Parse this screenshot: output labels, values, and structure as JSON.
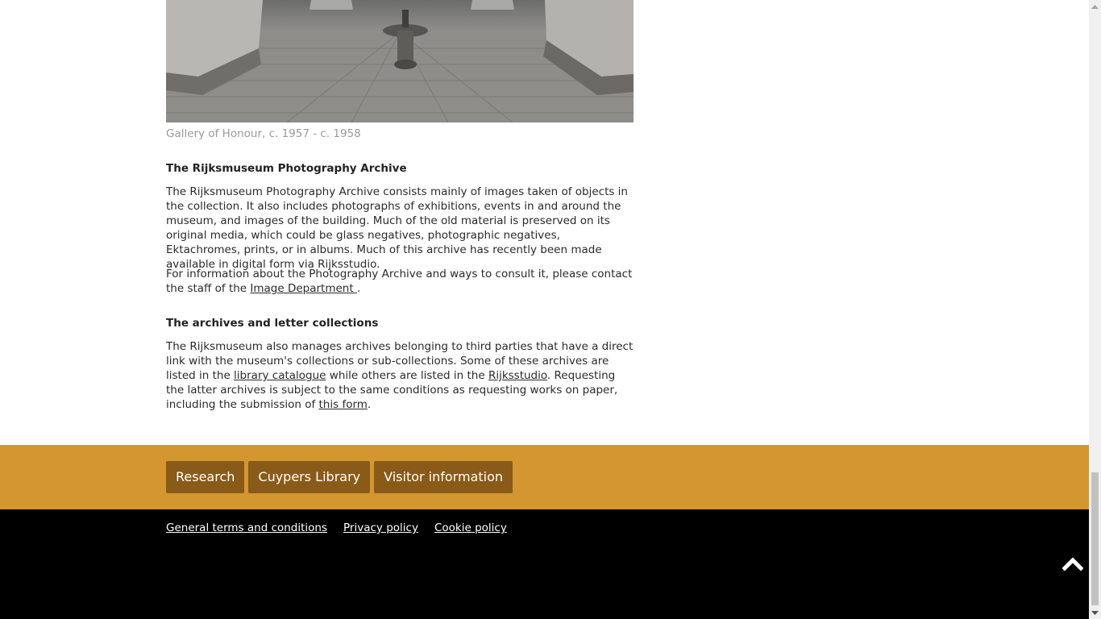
{
  "photo": {
    "alt": "Gallery of Honour, c. 1957 - c. 1958",
    "caption": "Gallery of Honour, c. 1957 - c. 1958"
  },
  "photo_archive": {
    "heading": "The Rijksmuseum Photography Archive",
    "paragraph1": "The Rijksmuseum Photography Archive consists mainly of images taken of objects in the collection. It also includes photographs of exhibitions, events in and around the museum, and images of the building. Much of the old material is preserved on its original media, which could be glass negatives, photographic negatives, Ektachromes, prints, or in albums. Much of this archive has recently been made available in digital form via Rijksstudio.",
    "paragraph2_before": "For information about the Photography Archive and ways to consult it, please contact the staff of the ",
    "paragraph2_link": "Image Department ",
    "paragraph2_after": "."
  },
  "archives": {
    "heading": "The archives and letter collections",
    "text1": "The Rijksmuseum also manages archives belonging to third parties that have a direct link with the museum's collections or sub-collections. Some of these archives are listed in the ",
    "link1": "library catalogue",
    "text2": " while others are listed in the ",
    "link2": "Rijksstudio",
    "text3": ". Requesting the latter archives is subject to the same conditions as requesting works on paper, including the submission of ",
    "link3": "this form",
    "text4": "."
  },
  "band": {
    "buttons": [
      "Research",
      "Cuypers Library",
      "Visitor information"
    ],
    "color": "#d39630",
    "button_color": "#8a5a18"
  },
  "footer": {
    "links": [
      "General terms and conditions ",
      "Privacy policy ",
      "Cookie policy"
    ],
    "back_to_top_icon": "chevron-up-icon"
  }
}
